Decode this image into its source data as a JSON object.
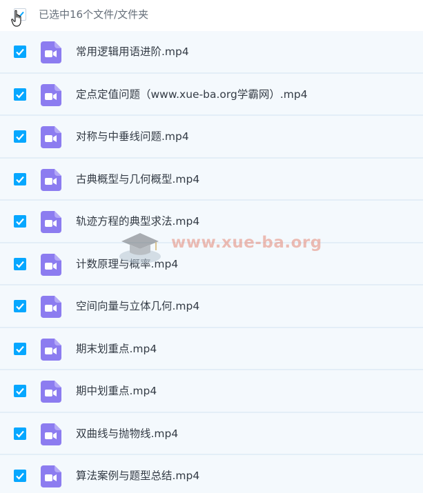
{
  "header": {
    "selection_label": "已选中16个文件/文件夹"
  },
  "files": [
    {
      "name": "常用逻辑用语进阶.mp4"
    },
    {
      "name": "定点定值问题（www.xue-ba.org学霸网）.mp4"
    },
    {
      "name": "对称与中垂线问题.mp4"
    },
    {
      "name": "古典概型与几何概型.mp4"
    },
    {
      "name": "轨迹方程的典型求法.mp4"
    },
    {
      "name": "计数原理与概率.mp4"
    },
    {
      "name": "空间向量与立体几何.mp4"
    },
    {
      "name": "期末划重点.mp4"
    },
    {
      "name": "期中划重点.mp4"
    },
    {
      "name": "双曲线与抛物线.mp4"
    },
    {
      "name": "算法案例与题型总结.mp4"
    }
  ],
  "watermark": {
    "text": "www.xue-ba.org"
  },
  "colors": {
    "checkbox": "#06a7ff",
    "video_icon": "#8c7cf0",
    "row_background": "#f4f9fd",
    "row_divider": "#e3eef7"
  },
  "icons": {
    "file": "video-file-icon",
    "check": "check-icon",
    "cursor": "hand-cursor-icon"
  }
}
